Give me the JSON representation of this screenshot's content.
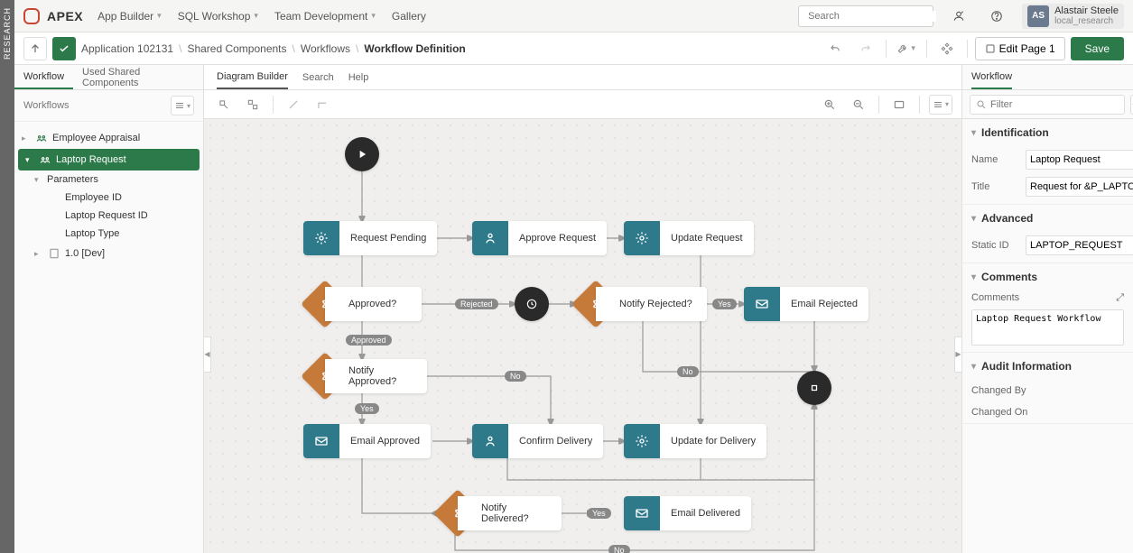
{
  "brand": "APEX",
  "nav": {
    "app_builder": "App Builder",
    "sql_workshop": "SQL Workshop",
    "team_dev": "Team Development",
    "gallery": "Gallery"
  },
  "search": {
    "placeholder": "Search"
  },
  "user": {
    "initials": "AS",
    "name": "Alastair Steele",
    "workspace": "local_research"
  },
  "research_tab": "RESEARCH",
  "breadcrumb": {
    "app": "Application 102131",
    "shared": "Shared Components",
    "workflows": "Workflows",
    "current": "Workflow Definition"
  },
  "toolbar": {
    "edit_page": "Edit Page 1",
    "save": "Save"
  },
  "left": {
    "tabs": {
      "workflow": "Workflow",
      "used": "Used Shared Components"
    },
    "title": "Workflows",
    "tree": {
      "emp": "Employee Appraisal",
      "laptop": "Laptop Request",
      "params": "Parameters",
      "p_emp": "Employee ID",
      "p_req": "Laptop Request ID",
      "p_type": "Laptop Type",
      "ver": "1.0 [Dev]"
    }
  },
  "center": {
    "tabs": {
      "diagram": "Diagram Builder",
      "search": "Search",
      "help": "Help"
    }
  },
  "right": {
    "tab": "Workflow",
    "filter_placeholder": "Filter",
    "sections": {
      "ident": "Identification",
      "adv": "Advanced",
      "comments": "Comments",
      "audit": "Audit Information"
    },
    "fields": {
      "name_label": "Name",
      "name_value": "Laptop Request",
      "title_label": "Title",
      "title_value": "Request for &P_LAPTOP_TY",
      "static_label": "Static ID",
      "static_value": "LAPTOP_REQUEST",
      "comments_label": "Comments",
      "comments_value": "Laptop Request Workflow",
      "changed_by": "Changed By",
      "changed_on": "Changed On"
    }
  },
  "wf": {
    "request_pending": "Request Pending",
    "approve_request": "Approve Request",
    "update_request": "Update Request",
    "approved_q": "Approved?",
    "notify_rejected": "Notify Rejected?",
    "email_rejected": "Email Rejected",
    "notify_approved": "Notify Approved?",
    "email_approved": "Email Approved",
    "confirm_delivery": "Confirm Delivery",
    "update_delivery": "Update for Delivery",
    "notify_delivered": "Notify Delivered?",
    "email_delivered": "Email Delivered",
    "rejected": "Rejected",
    "approved": "Approved",
    "yes": "Yes",
    "no": "No"
  }
}
